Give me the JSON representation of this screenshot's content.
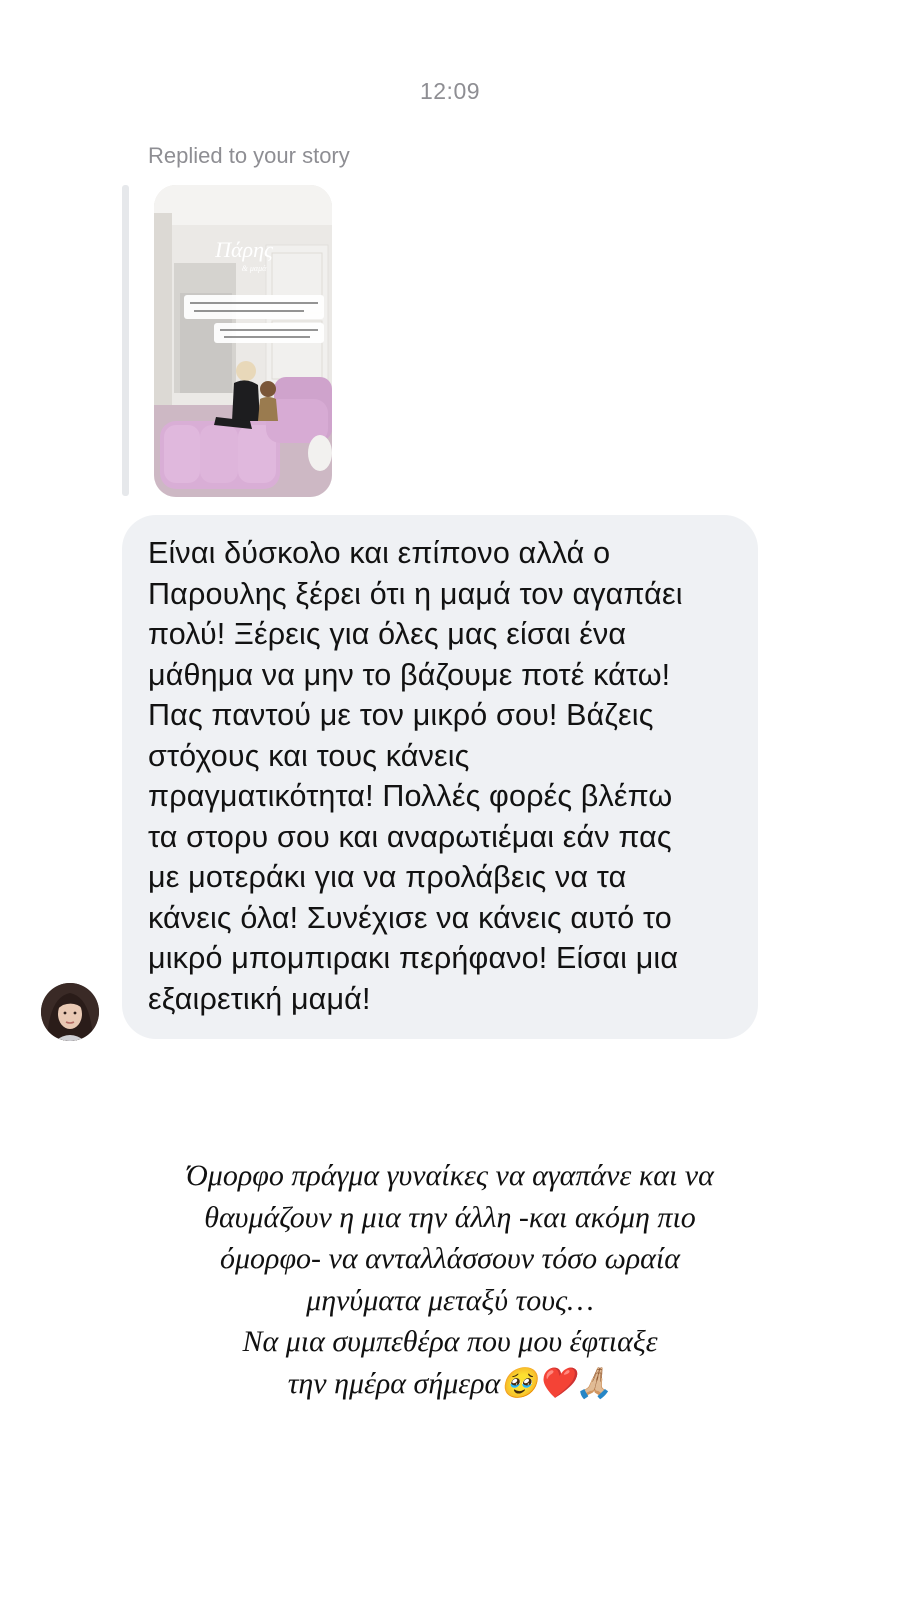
{
  "thread": {
    "timestamp": "12:09",
    "replied_label": "Replied to your story",
    "story": {
      "overlay_name": "Πάρης",
      "overlay_sub": "& μαμά",
      "overlay_note1": "Σήμερα το μωράκι μου φεύγει Αθήνα για 10 μέρες… και νιώθω ήδη τόσο κενή!",
      "overlay_note2": "Νομίζω αυτό είναι το πιο δύσκολο κομμάτι που έχω να αντιμετωπίσω κάθε μέρα…"
    },
    "message": {
      "text": "Είναι δύσκολο και επίπονο αλλά ο\nΠαρουλης ξέρει ότι η μαμά τον αγαπάει\nπολύ! Ξέρεις για όλες μας είσαι ένα\nμάθημα να μην το βάζουμε ποτέ κάτω!\nΠας παντού με τον μικρό σου! Βάζεις\nστόχους και τους κάνεις\nπραγματικότητα! Πολλές φορές βλέπω\nτα στορυ σου και αναρωτιέμαι εάν πας\nμε μοτεράκι για να προλάβεις να τα\nκάνεις όλα! Συνέχισε να κάνεις αυτό το\nμικρό μπομπιρακι περήφανο! Είσαι μια\nεξαιρετική μαμά!"
    },
    "avatar_icon": "profile-photo"
  },
  "caption": {
    "text": "Όμορφο πράγμα γυναίκες να αγαπάνε και να\nθαυμάζουν η μια την άλλη -και ακόμη πιο\nόμορφο- να ανταλλάσσουν τόσο ωραία\nμηνύματα μεταξύ τους…\nΝα μια συμπεθέρα που μου έφτιαξε\nτην ημέρα σήμερα🥹❤️🙏🏼"
  },
  "colors": {
    "bubble_bg": "#eff1f4",
    "meta_text": "#8e8e93",
    "reply_rule": "#e6e8eb",
    "sofa_pink": "#d9aed6"
  }
}
